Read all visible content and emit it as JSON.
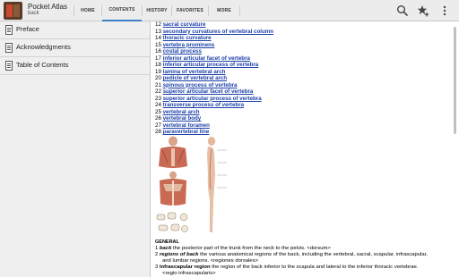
{
  "app": {
    "title": "Pocket Atlas",
    "subtitle": "back"
  },
  "tabs": [
    {
      "label": "HOME"
    },
    {
      "label": "CONTENTS"
    },
    {
      "label": "HISTORY"
    },
    {
      "label": "FAVORITES"
    },
    {
      "label": "MORE"
    }
  ],
  "actions": [
    "search-icon",
    "star-add-icon",
    "overflow-menu-icon"
  ],
  "sidebar": {
    "items": [
      {
        "label": "Preface"
      },
      {
        "label": "Acknowledgments"
      },
      {
        "label": "Table of Contents"
      }
    ]
  },
  "content": {
    "list": [
      {
        "num": "12",
        "text": "sacral curvature"
      },
      {
        "num": "13",
        "text": "secondary curvatures of vertebral column"
      },
      {
        "num": "14",
        "text": "thoracic curvature"
      },
      {
        "num": "15",
        "text": "vertebra prominens"
      },
      {
        "num": "16",
        "text": "costal process"
      },
      {
        "num": "17",
        "text": "inferior articular facet of vertebra"
      },
      {
        "num": "18",
        "text": "inferior articular process of vertebra"
      },
      {
        "num": "19",
        "text": "lamina of vertebral arch"
      },
      {
        "num": "20",
        "text": "pedicle of vertebral arch"
      },
      {
        "num": "21",
        "text": "spinous process of vertebra"
      },
      {
        "num": "22",
        "text": "superior articular facet of vertebra"
      },
      {
        "num": "23",
        "text": "superior articular process of vertebra"
      },
      {
        "num": "24",
        "text": "transverse process of vertebra"
      },
      {
        "num": "25",
        "text": "vertebral arch"
      },
      {
        "num": "26",
        "text": "vertebral body"
      },
      {
        "num": "27",
        "text": "vertebral foramen"
      },
      {
        "num": "28",
        "text": "paravertebral line"
      }
    ],
    "section_heading": "GENERAL",
    "general": [
      {
        "num": "1",
        "term": "back",
        "text": " the posterior part of the trunk from the neck to the pelvis. <dorsum>"
      },
      {
        "num": "2",
        "term": "regions of back",
        "text": " the various  anatomical regions of the back, including the vertebral, sacral, scapular, infrascapular,"
      },
      {
        "num": "",
        "term": "",
        "text": "and lumbar regions. <regiones dorsales>"
      },
      {
        "num": "3",
        "term": "infrascapular region",
        "text": " the region of the back inferior to the scapula and lateral to the inferior thoracic vertebrae."
      },
      {
        "num": "",
        "term": "",
        "text": "<regio infrascapularis>"
      }
    ]
  }
}
